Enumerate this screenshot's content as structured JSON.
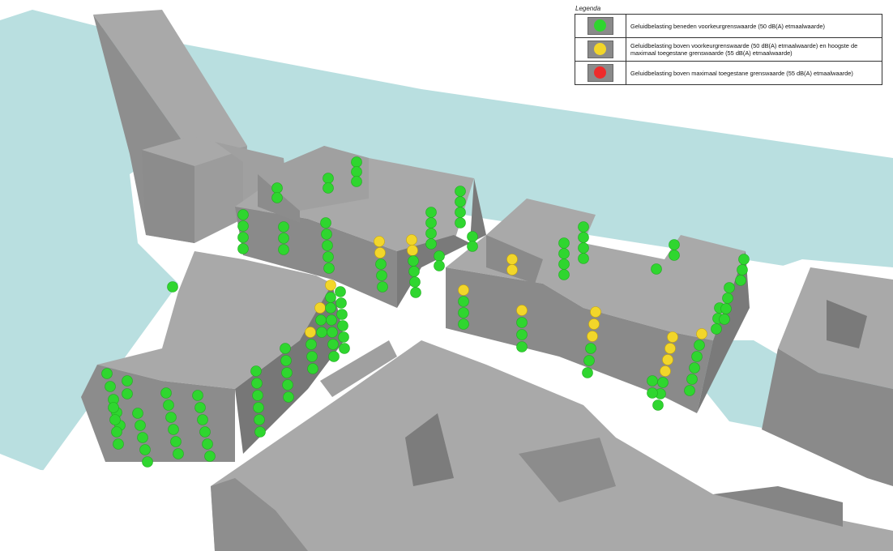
{
  "legend": {
    "title": "Legenda",
    "items": [
      {
        "label": "Geluidbelasting beneden voorkeurgrenswaarde (50 dB(A) etmaalwaarde)",
        "color": "#2fd62f"
      },
      {
        "label": "Geluidbelasting boven voorkeurgrenswaarde (50 dB(A) etmaalwaarde) en hoogste de maximaal toegestane grenswaarde (55 dB(A) etmaalwaarde)",
        "color": "#f2d62a"
      },
      {
        "label": "Geluidbelasting boven maximaal toegestane grenswaarde (55 dB(A) etmaalwaarde)",
        "color": "#ee2b2b"
      }
    ]
  },
  "colors": {
    "water": "#b9dfe0",
    "ground": "#ffffff",
    "roof": "#a9a9a9",
    "wall_light": "#8c8c8c",
    "wall_dark": "#747474"
  }
}
